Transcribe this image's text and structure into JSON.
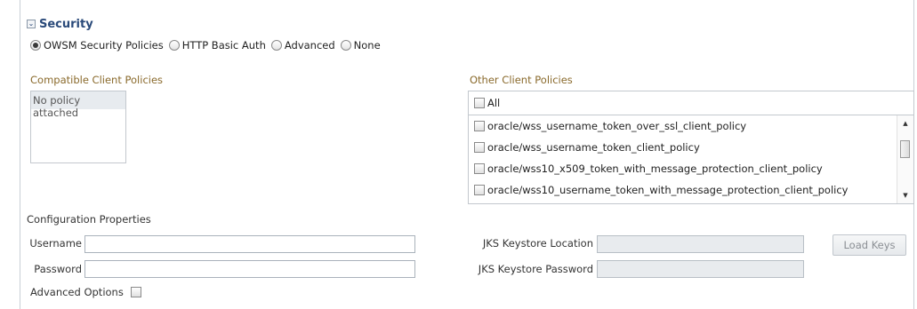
{
  "section": {
    "title": "Security",
    "toggle_icon": "collapse-chevron-icon"
  },
  "auth_options": [
    {
      "label": "OWSM Security Policies",
      "selected": true
    },
    {
      "label": "HTTP Basic Auth",
      "selected": false
    },
    {
      "label": "Advanced",
      "selected": false
    },
    {
      "label": "None",
      "selected": false
    }
  ],
  "compatible_policies": {
    "title": "Compatible Client Policies",
    "items": [
      "No policy attached"
    ]
  },
  "other_policies": {
    "title": "Other Client Policies",
    "all_label": "All",
    "items": [
      "oracle/wss_username_token_over_ssl_client_policy",
      "oracle/wss_username_token_client_policy",
      "oracle/wss10_x509_token_with_message_protection_client_policy",
      "oracle/wss10_username_token_with_message_protection_client_policy"
    ]
  },
  "config": {
    "title": "Configuration Properties",
    "username_label": "Username",
    "username_value": "",
    "password_label": "Password",
    "password_value": "",
    "jks_location_label": "JKS Keystore Location",
    "jks_location_value": "",
    "jks_password_label": "JKS Keystore Password",
    "jks_password_value": "",
    "load_keys_label": "Load Keys",
    "advanced_label": "Advanced Options"
  },
  "colors": {
    "section_title": "#2a4a7a",
    "group_label": "#8a6a2c",
    "selected_row": "#e7ebef",
    "disabled_field": "#e8ebee"
  }
}
